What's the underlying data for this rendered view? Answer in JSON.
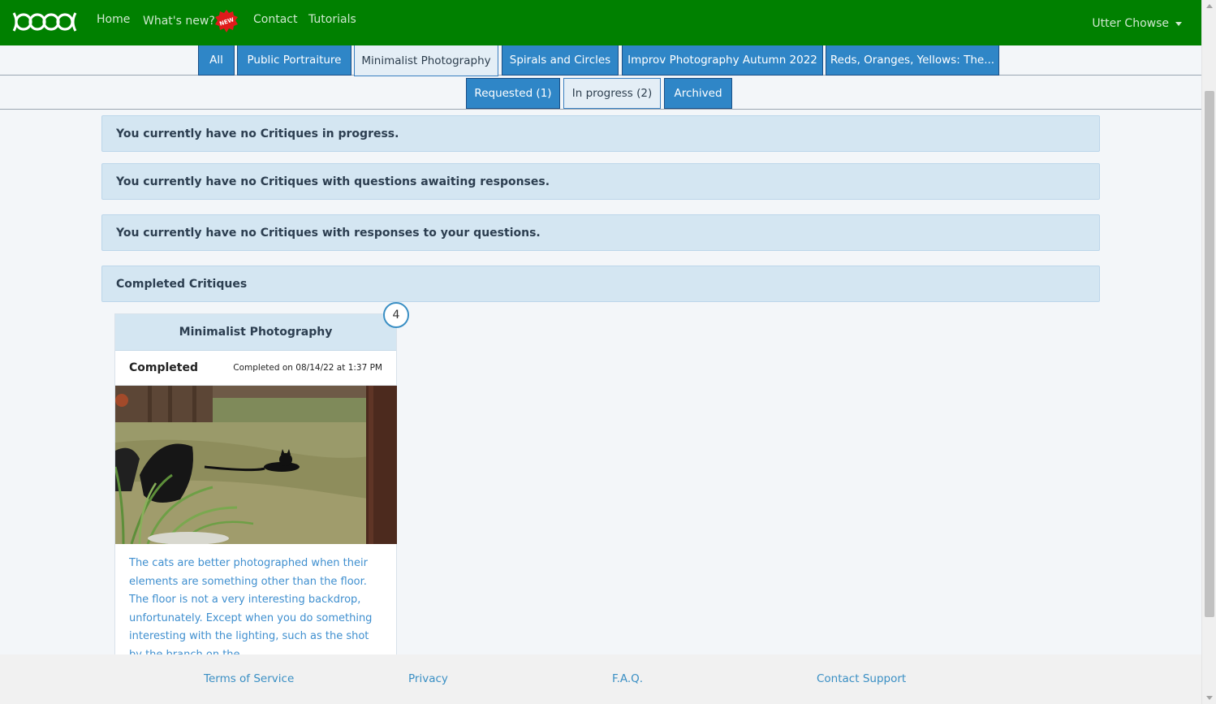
{
  "navbar": {
    "links": [
      "Home",
      "What's new?",
      "Contact",
      "Tutorials"
    ],
    "new_badge": "NEW",
    "user_name": "Utter Chowse",
    "bg_color": "#008000"
  },
  "group_tabs": [
    {
      "label": "All",
      "active": false
    },
    {
      "label": "Public Portraiture",
      "active": false
    },
    {
      "label": "Minimalist Photography",
      "active": true
    },
    {
      "label": "Spirals and Circles",
      "active": false
    },
    {
      "label": "Improv Photography Autumn 2022",
      "active": false
    },
    {
      "label": "Reds, Oranges, Yellows: The...",
      "active": false
    }
  ],
  "status_tabs": [
    {
      "label": "Requested (1)",
      "active": false
    },
    {
      "label": "In progress (2)",
      "active": true
    },
    {
      "label": "Archived",
      "active": false
    }
  ],
  "panels": {
    "in_progress": "You currently have no Critiques in progress.",
    "awaiting": "You currently have no Critiques with questions awaiting responses.",
    "responses": "You currently have no Critiques with responses to your questions.",
    "completed_header": "Completed Critiques"
  },
  "card": {
    "title": "Minimalist Photography",
    "count": "4",
    "status": "Completed",
    "date": "Completed on 08/14/22 at 1:37 PM",
    "text": "The cats are better photographed when their elements are something other than the floor. The floor is not a very interesting backdrop, unfortunately. Except when you do something interesting with the lighting, such as the shot by the branch on the..."
  },
  "footer": {
    "links": [
      "Terms of Service",
      "Privacy",
      "F.A.Q.",
      "Contact Support"
    ]
  }
}
